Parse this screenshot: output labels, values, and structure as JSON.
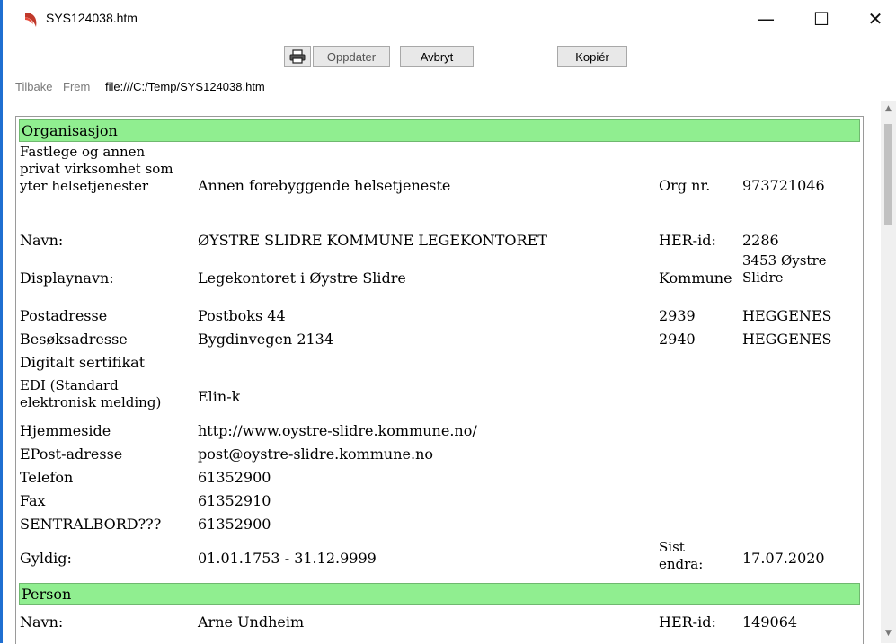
{
  "window": {
    "title": "SYS124038.htm",
    "minimize": "—",
    "maximize": "☐",
    "close": "✕"
  },
  "toolbar": {
    "print_icon": "printer-icon",
    "update_label": "Oppdater",
    "cancel_label": "Avbryt",
    "copy_label": "Kopiér"
  },
  "nav": {
    "back_label": "Tilbake",
    "forward_label": "Frem",
    "url": "file:///C:/Temp/SYS124038.htm"
  },
  "colors": {
    "section_bg": "#90ee90",
    "accent": "#1f6fd1"
  },
  "organisasjon": {
    "header": "Organisasjon",
    "type_label": "Fastlege og annen privat virksomhet som yter helsetjenester",
    "type_value": "Annen forebyggende helsetjeneste",
    "orgnr_label": "Org nr.",
    "orgnr_value": "973721046",
    "navn_label": "Navn:",
    "navn_value": "ØYSTRE SLIDRE KOMMUNE LEGEKONTORET",
    "herid_label": "HER-id:",
    "herid_value": "2286",
    "displaynavn_label": "Displaynavn:",
    "displaynavn_value": "Legekontoret i Øystre Slidre",
    "kommune_label": "Kommune",
    "kommune_value": "3453 Øystre Slidre",
    "postadresse_label": "Postadresse",
    "postadresse_value": "Postboks 44",
    "post_postnr": "2939",
    "post_sted": "HEGGENES",
    "besok_label": "Besøksadresse",
    "besok_value": "Bygdinvegen 2134",
    "besok_postnr": "2940",
    "besok_sted": "HEGGENES",
    "sertifikat_label": "Digitalt sertifikat",
    "edi_label": "EDI (Standard elektronisk melding)",
    "edi_value": "Elin-k",
    "hjemmeside_label": "Hjemmeside",
    "hjemmeside_value": "http://www.oystre-slidre.kommune.no/",
    "epost_label": "EPost-adresse",
    "epost_value": "post@oystre-slidre.kommune.no",
    "telefon_label": "Telefon",
    "telefon_value": "61352900",
    "fax_label": "Fax",
    "fax_value": "61352910",
    "sentralbord_label": "SENTRALBORD???",
    "sentralbord_value": "61352900",
    "gyldig_label": "Gyldig:",
    "gyldig_value": "01.01.1753 - 31.12.9999",
    "sist_label": "Sist endra:",
    "sist_value": "17.07.2020"
  },
  "person": {
    "header": "Person",
    "navn_label": "Navn:",
    "navn_value": "Arne Undheim",
    "herid_label": "HER-id:",
    "herid_value": "149064"
  }
}
